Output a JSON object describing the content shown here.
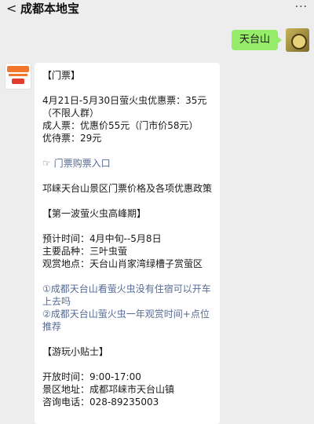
{
  "header": {
    "title": "成都本地宝",
    "back": "<",
    "more": "···"
  },
  "outgoing": {
    "text": "天台山"
  },
  "incoming": {
    "ticket_heading": "【门票】",
    "discount_line": "4月21日-5月30日萤火虫优惠票：35元（不限人群）",
    "adult_line": "成人票：优惠价55元（门市价58元）",
    "concession_line": "优待票：29元",
    "buy_link": "☞ 门票购票入口",
    "policy_line": "邛崃天台山景区门票价格及各项优惠政策",
    "wave_heading": "【第一波萤火虫高峰期】",
    "expected_time": "预计时间：4月中旬--5月8日",
    "species": "主要品种：三叶虫萤",
    "spot": "观赏地点：天台山肖家湾绿槽子赏萤区",
    "link1": "①成都天台山看萤火虫没有住宿可以开车上去吗",
    "link2": "②成都天台山萤火虫一年观赏时间+点位推荐",
    "tips_heading": "【游玩小贴士】",
    "open_time": "开放时间：9:00-17:00",
    "address": "景区地址：成都邛崃市天台山镇",
    "phone": "咨询电话：028-89235003"
  }
}
